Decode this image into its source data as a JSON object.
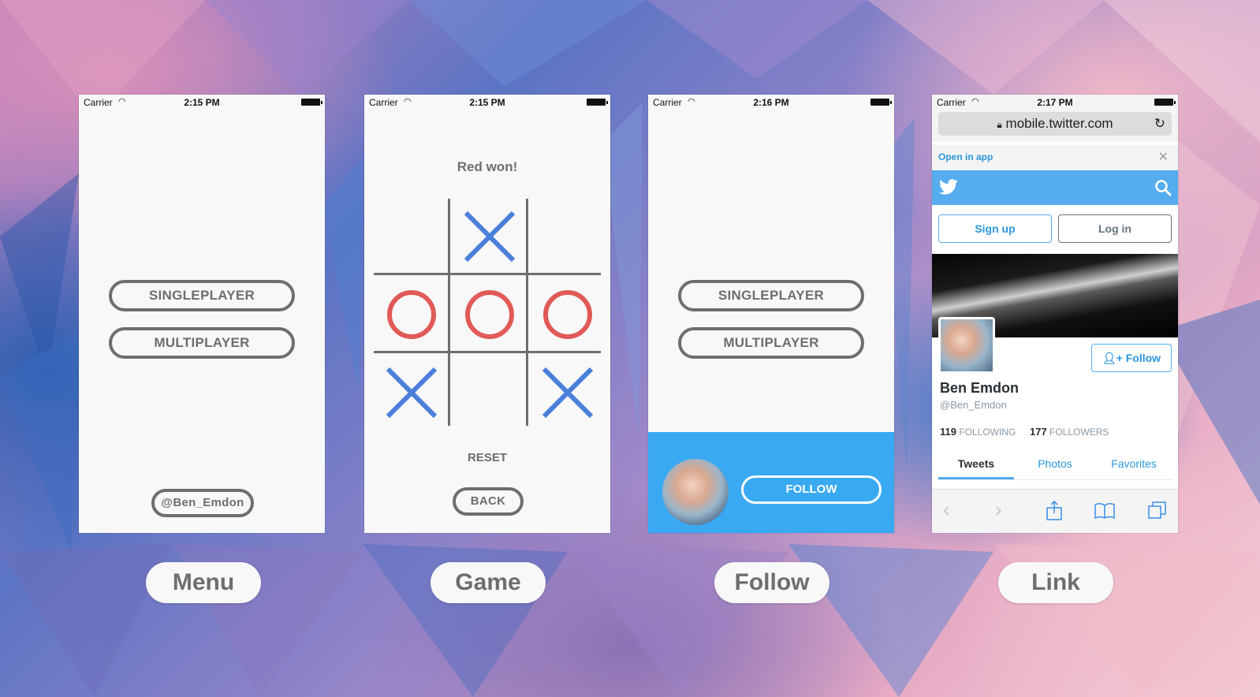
{
  "screens": {
    "menu": {
      "status": {
        "carrier": "Carrier",
        "time": "2:15 PM"
      },
      "singleplayer": "SINGLEPLAYER",
      "multiplayer": "MULTIPLAYER",
      "handle": "@Ben_Emdon",
      "caption": "Menu"
    },
    "game": {
      "status": {
        "carrier": "Carrier",
        "time": "2:15 PM"
      },
      "result": "Red won!",
      "board": [
        "",
        "X",
        "",
        "O",
        "O",
        "O",
        "X",
        "",
        "X"
      ],
      "reset": "RESET",
      "back": "BACK",
      "caption": "Game"
    },
    "follow": {
      "status": {
        "carrier": "Carrier",
        "time": "2:16 PM"
      },
      "singleplayer": "SINGLEPLAYER",
      "multiplayer": "MULTIPLAYER",
      "follow_button": "FOLLOW",
      "caption": "Follow"
    },
    "link": {
      "status": {
        "carrier": "Carrier",
        "time": "2:17 PM"
      },
      "url": "mobile.twitter.com",
      "open_in_app": "Open in app",
      "sign_up": "Sign up",
      "log_in": "Log in",
      "follow": "Follow",
      "name": "Ben Emdon",
      "handle": "@Ben_Emdon",
      "following_count": "119",
      "following_label": "FOLLOWING",
      "followers_count": "177",
      "followers_label": "FOLLOWERS",
      "tabs": [
        "Tweets",
        "Photos",
        "Favorites"
      ],
      "caption": "Link"
    }
  },
  "colors": {
    "x_color": "#4a7fdb",
    "o_color": "#e05a57",
    "twitter_blue": "#55acee",
    "follow_bar": "#39a9f2",
    "pill_gray": "#6e6e6e"
  },
  "icons": [
    "wifi-icon",
    "battery-icon",
    "lock-icon",
    "reload-icon",
    "close-icon",
    "twitter-bird-icon",
    "search-icon",
    "add-user-icon",
    "back-arrow-icon",
    "forward-arrow-icon",
    "share-icon",
    "bookmarks-icon",
    "tabs-icon"
  ]
}
